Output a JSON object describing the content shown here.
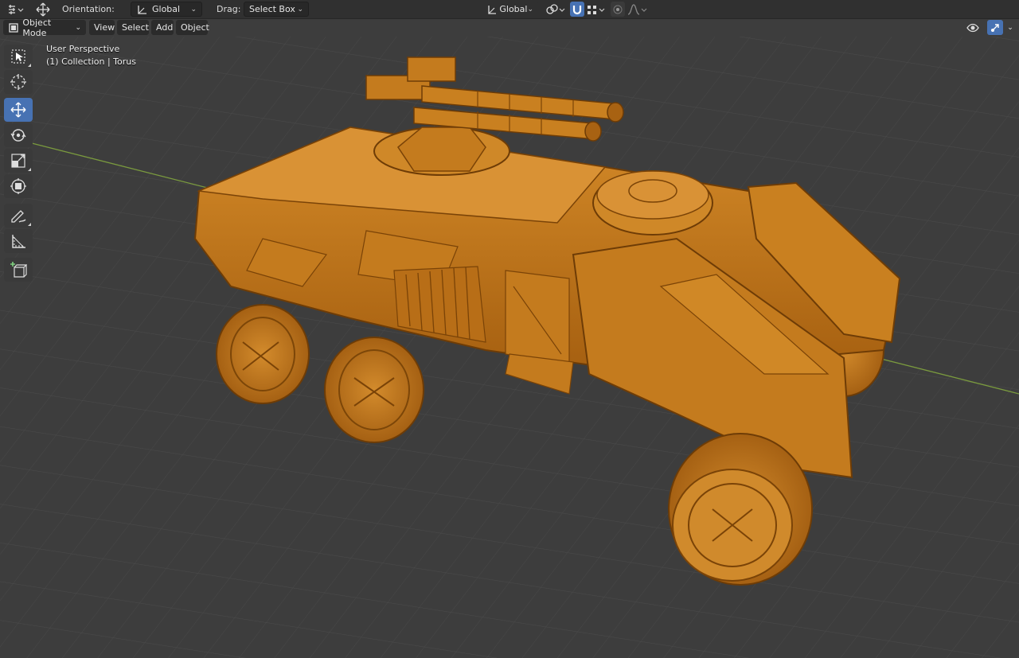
{
  "tool_settings": {
    "orientation_label": "Orientation:",
    "orientation_value": "Global",
    "drag_label": "Drag:",
    "drag_value": "Select Box",
    "transform_orientation": "Global"
  },
  "header": {
    "mode": "Object Mode",
    "menus": [
      "View",
      "Select",
      "Add",
      "Object"
    ]
  },
  "viewport": {
    "perspective": "User Perspective",
    "collection": "(1) Collection | Torus",
    "background_color": "#3d3d3d",
    "grid_color": "#4a4a4a",
    "x_axis_color": "#7a9a3e",
    "model_color": "#c87a1a"
  },
  "toolbar": {
    "tools": [
      "select-box",
      "cursor",
      "move",
      "rotate",
      "scale",
      "transform",
      "annotate",
      "measure",
      "add-cube"
    ],
    "active_tool": "move"
  },
  "icons": {
    "editor_type": "transform-gizmo-icon",
    "move_mode": "move-arrows-icon",
    "orientation": "axes-icon",
    "pivot": "link-icon",
    "snap": "magnet-icon",
    "snap_target": "grid-snap-icon",
    "proportional": "circle-dot-icon",
    "falloff": "curve-icon",
    "visibility": "eye-icon",
    "gizmo": "gizmo-icon"
  }
}
